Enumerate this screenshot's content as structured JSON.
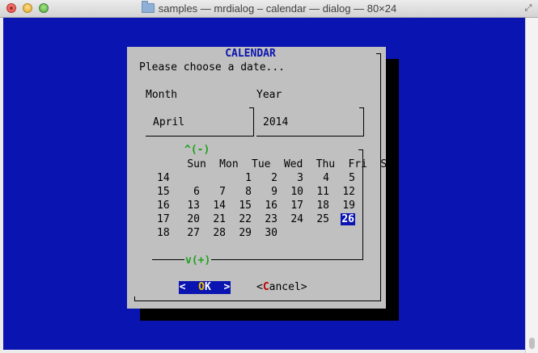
{
  "window": {
    "title": "samples — mrdialog – calendar — dialog — 80×24"
  },
  "dialog": {
    "title": "CALENDAR",
    "prompt": "Please choose a date...",
    "month_label": "Month",
    "year_label": "Year",
    "month_value": "April",
    "year_value": "2014",
    "scroll_up_hint": "^(-)",
    "scroll_down_hint": "v(+)",
    "weekdays": [
      "Sun",
      "Mon",
      "Tue",
      "Wed",
      "Thu",
      "Fri",
      "Sat"
    ],
    "weeks": [
      {
        "week": "14",
        "days": [
          "",
          "",
          "1",
          "2",
          "3",
          "4",
          "5"
        ]
      },
      {
        "week": "15",
        "days": [
          "6",
          "7",
          "8",
          "9",
          "10",
          "11",
          "12"
        ]
      },
      {
        "week": "16",
        "days": [
          "13",
          "14",
          "15",
          "16",
          "17",
          "18",
          "19"
        ]
      },
      {
        "week": "17",
        "days": [
          "20",
          "21",
          "22",
          "23",
          "24",
          "25",
          "26"
        ]
      },
      {
        "week": "18",
        "days": [
          "27",
          "28",
          "29",
          "30",
          "",
          "",
          ""
        ]
      }
    ],
    "selected_day": "26",
    "ok": {
      "left": "<",
      "pre": " ",
      "hotkey": "O",
      "rest": "K",
      "right": ">"
    },
    "cancel": {
      "left": "<",
      "hotkey": "C",
      "rest": "ancel",
      "right": ">"
    }
  },
  "colors": {
    "terminal_bg": "#0a14b0",
    "dialog_bg": "#c0c0c0",
    "title_fg": "#0a14b0",
    "scroll_hint": "#1ca21c",
    "ok_hotkey": "#f0c000",
    "cancel_hotkey": "#c00000"
  },
  "icons": [
    "close-icon",
    "minimize-icon",
    "zoom-icon",
    "folder-icon",
    "fullscreen-icon"
  ]
}
